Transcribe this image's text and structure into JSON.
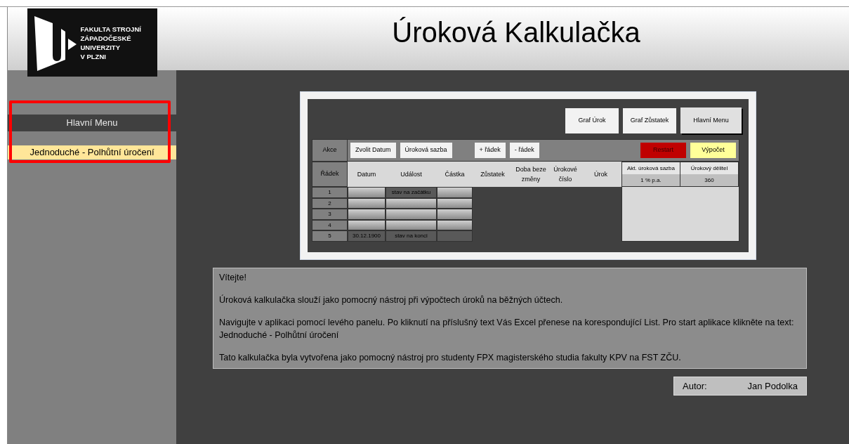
{
  "header": {
    "title": "Úroková Kalkulačka"
  },
  "logo": {
    "lines": [
      "FAKULTA STROJNÍ",
      "ZÁPADOČESKÉ",
      "UNIVERZITY",
      "V PLZNI"
    ]
  },
  "sidebar": {
    "highlighted": true,
    "items": [
      {
        "label": "Hlavní Menu",
        "selected": false
      },
      {
        "label": "Jednoduché - Polhůtní úročení",
        "selected": true
      }
    ]
  },
  "preview": {
    "top_buttons": [
      "Graf Úrok",
      "Graf Zůstatek",
      "Hlavní Menu"
    ],
    "action_label": "Akce",
    "actions": [
      {
        "label": "Zvolit Datum",
        "kind": "plain"
      },
      {
        "label": "Úroková sazba",
        "kind": "plain"
      },
      {
        "label": "+ řádek",
        "kind": "plain"
      },
      {
        "label": "- řádek",
        "kind": "plain"
      },
      {
        "label": "Restart",
        "kind": "danger"
      },
      {
        "label": "Výpočet",
        "kind": "warning"
      }
    ],
    "row_label": "Řádek",
    "columns": [
      "Datum",
      "Událost",
      "Částka",
      "Zůstatek",
      "Doba beze změny",
      "Úrokové číslo",
      "Úrok"
    ],
    "rate": [
      {
        "heading": "Akt. úroková sazba",
        "value": "1 %  p.a."
      },
      {
        "heading": "Úrokový dělitel",
        "value": "360"
      }
    ],
    "rows": [
      {
        "number": "1",
        "datum": "",
        "udalost": "stav na začátku",
        "castka": ""
      },
      {
        "number": "2",
        "datum": "",
        "udalost": "",
        "castka": ""
      },
      {
        "number": "3",
        "datum": "",
        "udalost": "",
        "castka": ""
      },
      {
        "number": "4",
        "datum": "",
        "udalost": "",
        "castka": ""
      },
      {
        "number": "5",
        "datum": "30.12.1900",
        "udalost": "stav na konci",
        "castka": ""
      }
    ]
  },
  "intro": {
    "paragraphs": [
      "Vítejte!",
      "Úroková kalkulačka slouží jako pomocný nástroj při výpočtech úroků na běžných účtech.",
      "Navigujte v aplikaci pomocí levého panelu. Po kliknutí na příslušný text Vás Excel přenese na korespondující List. Pro start aplikace klikněte na text: Jednoduché - Polhůtní úročení",
      "Tato kalkulačka byla vytvořena jako pomocný nástroj pro studenty FPX magisterského studia fakulty KPV na FST ZČU."
    ]
  },
  "author": {
    "label": "Autor:",
    "name": "Jan Podolka"
  }
}
